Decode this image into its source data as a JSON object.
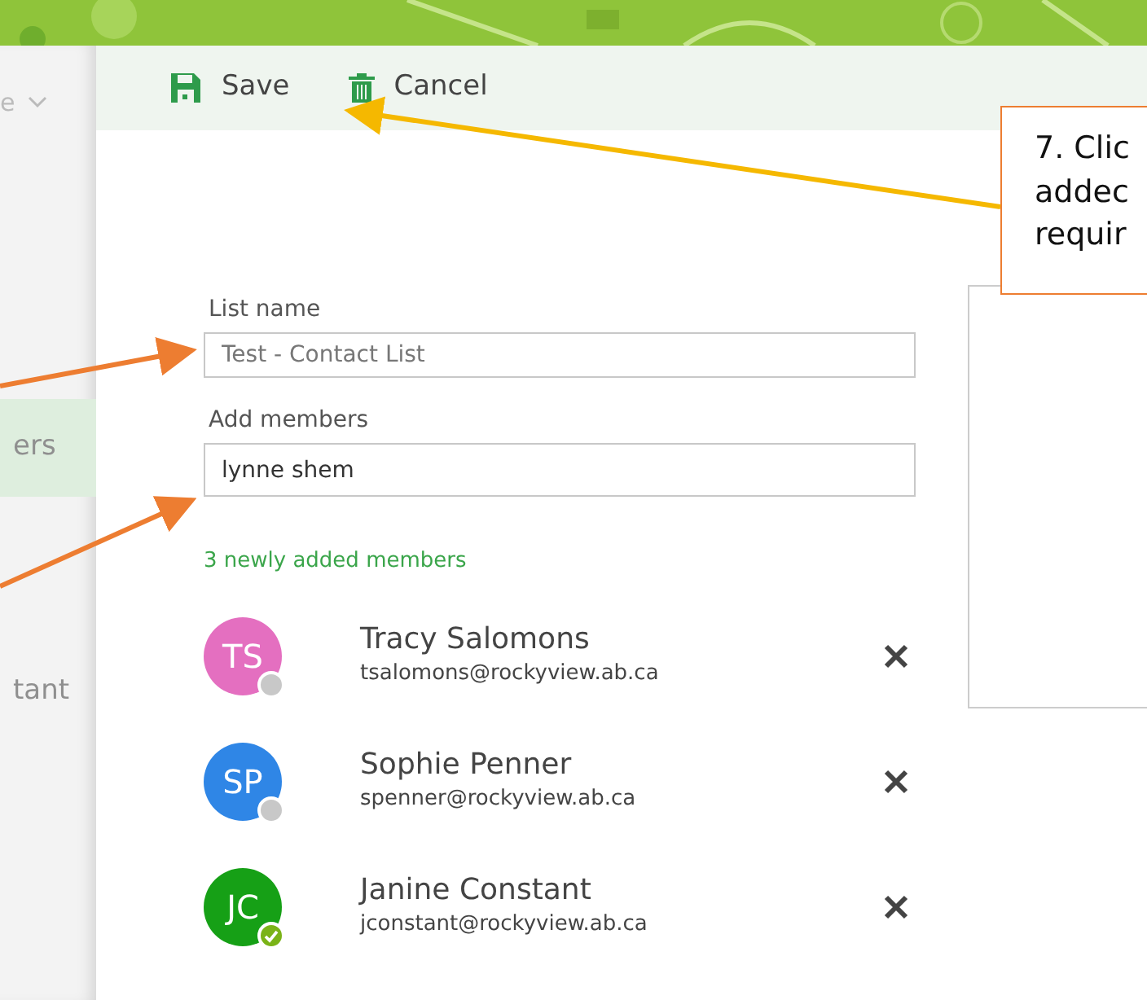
{
  "sidebar": {
    "header": {
      "text": "e"
    },
    "items": [
      {
        "label": "ers",
        "selected": true
      },
      {
        "label": "tant",
        "selected": false
      }
    ]
  },
  "toolbar": {
    "buttons": [
      {
        "kind": "save",
        "label": "Save"
      },
      {
        "kind": "delete",
        "label": "Cancel"
      }
    ]
  },
  "form": {
    "list_name": {
      "label": "List name",
      "placeholder": "Test - Contact List"
    },
    "add_members": {
      "label": "Add members",
      "value": "lynne shem"
    }
  },
  "members_heading": "3 newly added members",
  "members": [
    {
      "initials": "TS",
      "name": "Tracy Salomons",
      "email": "tsalomons@rockyview.ab.ca",
      "color": "#e46fc0",
      "available": false
    },
    {
      "initials": "SP",
      "name": "Sophie Penner",
      "email": "spenner@rockyview.ab.ca",
      "color": "#2f86e6",
      "available": false
    },
    {
      "initials": "JC",
      "name": "Janine Constant",
      "email": "jconstant@rockyview.ab.ca",
      "color": "#16a016",
      "available": true
    }
  ],
  "callout": {
    "lines": [
      "7. Clic",
      "addec",
      "requir"
    ]
  }
}
